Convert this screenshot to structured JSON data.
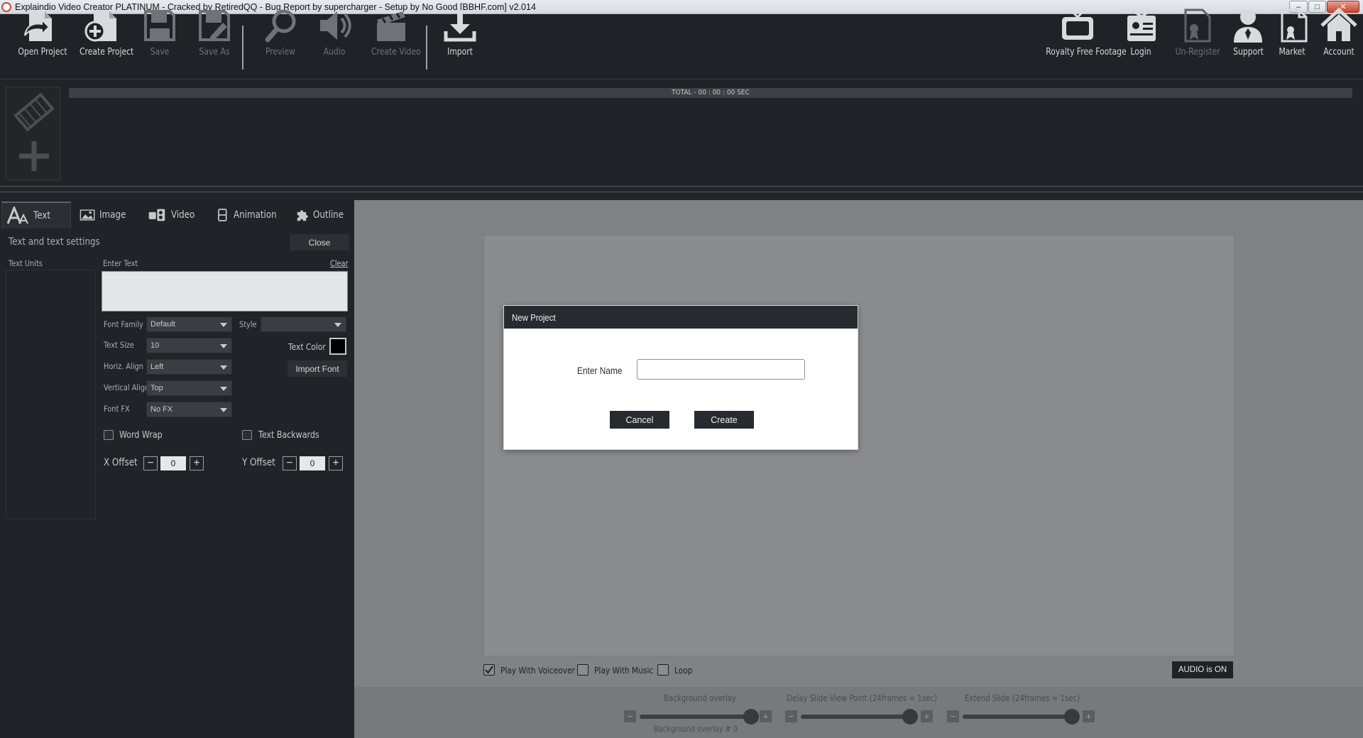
{
  "window": {
    "title": "Explaindio Video Creator PLATINUM - Cracked by RetiredQQ - Bug Report by supercharger - Setup by No Good [BBHF.com] v2.014"
  },
  "toolbar": {
    "left_buttons": [
      {
        "label": "Open Project",
        "icon": "open-project-icon",
        "enabled": true
      },
      {
        "label": "Create Project",
        "icon": "create-project-icon",
        "enabled": true
      },
      {
        "label": "Save",
        "icon": "save-icon",
        "enabled": false
      },
      {
        "label": "Save As",
        "icon": "save-as-icon",
        "enabled": false
      },
      {
        "label": "Preview",
        "icon": "magnifier-icon",
        "enabled": false
      },
      {
        "label": "Audio",
        "icon": "speaker-icon",
        "enabled": false
      },
      {
        "label": "Create Video",
        "icon": "clapperboard-icon",
        "enabled": false
      },
      {
        "label": "Import",
        "icon": "download-icon",
        "enabled": true
      }
    ],
    "right_buttons": [
      {
        "label": "Royalty Free Footage",
        "icon": "tv-icon",
        "enabled": true
      },
      {
        "label": "Login",
        "icon": "id-badge-icon",
        "enabled": true
      },
      {
        "label": "Un-Register",
        "icon": "certificate-icon",
        "enabled": false
      },
      {
        "label": "Support",
        "icon": "support-person-icon",
        "enabled": true
      },
      {
        "label": "Market",
        "icon": "market-document-icon",
        "enabled": true
      },
      {
        "label": "Account",
        "icon": "home-icon",
        "enabled": true
      }
    ]
  },
  "timeline": {
    "total_label": "TOTAL - 00 : 00 : 00 SEC"
  },
  "tabs": [
    {
      "label": "Text",
      "icon": "text-tab-icon",
      "active": true
    },
    {
      "label": "Image",
      "icon": "image-tab-icon",
      "active": false
    },
    {
      "label": "Video",
      "icon": "video-tab-icon",
      "active": false
    },
    {
      "label": "Animation",
      "icon": "animation-tab-icon",
      "active": false
    },
    {
      "label": "Outline",
      "icon": "puzzle-icon",
      "active": false
    }
  ],
  "text_panel": {
    "heading": "Text and text settings",
    "close_label": "Close",
    "units_label": "Text Units",
    "enter_text_label": "Enter Text",
    "clear_label": "Clear",
    "font_family_label": "Font Family",
    "font_family_value": "Default",
    "style_label": "Style",
    "style_value": "",
    "text_size_label": "Text Size",
    "text_size_value": "10",
    "text_color_label": "Text Color",
    "text_color_value": "#000000",
    "horiz_align_label": "Horiz. Align",
    "horiz_align_value": "Left",
    "import_font_label": "Import Font",
    "vertical_align_label": "Vertical Align",
    "vertical_align_value": "Top",
    "font_fx_label": "Font FX",
    "font_fx_value": "No FX",
    "word_wrap_label": "Word Wrap",
    "word_wrap_checked": false,
    "text_backwards_label": "Text Backwards",
    "text_backwards_checked": false,
    "x_offset_label": "X Offset",
    "x_offset_value": "0",
    "y_offset_label": "Y Offset",
    "y_offset_value": "0"
  },
  "playback": {
    "voiceover_label": "Play With Voiceover",
    "voiceover_checked": true,
    "music_label": "Play With Music",
    "music_checked": false,
    "loop_label": "Loop",
    "loop_checked": false,
    "audio_button": "AUDIO is ON"
  },
  "sliders": [
    {
      "label": "Background overlay",
      "sublabel": "Background overlay  # 0",
      "fraction": 0.97
    },
    {
      "label": "Delay Slide View Point (24frames = 1sec)",
      "sublabel": "",
      "fraction": 0.95
    },
    {
      "label": "Extend Slide (24frames = 1sec)",
      "sublabel": "",
      "fraction": 0.95
    }
  ],
  "modal": {
    "title": "New Project",
    "name_label": "Enter Name",
    "name_value": "",
    "cancel_label": "Cancel",
    "create_label": "Create"
  },
  "colors": {
    "toolbar_bg": "#1f2226",
    "panel_bg": "#202327",
    "workspace_bg": "#808285",
    "modal_header": "#272a2f"
  }
}
